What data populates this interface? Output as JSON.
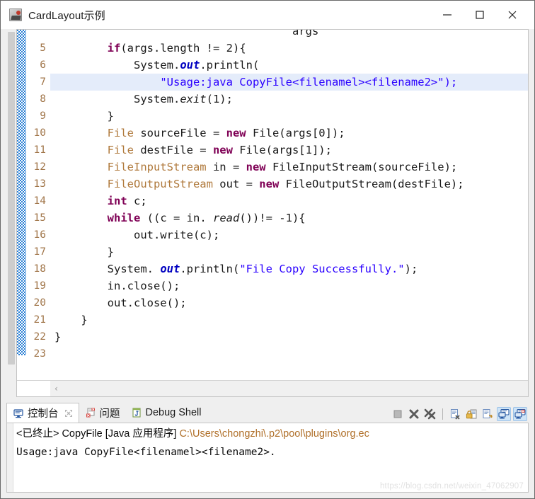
{
  "window": {
    "title": "CardLayout示例",
    "icon": "app-icon",
    "minimize_label": "—",
    "maximize_label": "□",
    "close_label": "✕"
  },
  "editor": {
    "first_visible_line": 5,
    "highlighted_line": 7,
    "line_numbers": [
      "5",
      "6",
      "7",
      "8",
      "9",
      "10",
      "11",
      "12",
      "13",
      "14",
      "15",
      "16",
      "17",
      "18",
      "19",
      "20",
      "21",
      "22",
      "23"
    ],
    "lines": [
      "        if(args.length != 2){",
      "            System.out.println(",
      "                \"Usage:java CopyFile<filenamel><filename2>\");",
      "            System.exit(1);",
      "        }",
      "        File sourceFile = new File(args[0]);",
      "        File destFile = new File(args[1]);",
      "        FileInputStream in = new FileInputStream(sourceFile);",
      "        FileOutputStream out = new FileOutputStream(destFile);",
      "        int c;",
      "        while ((c = in. read())!= -1){",
      "            out.write(c);",
      "        }",
      "        System. out.println(\"File Copy Successfully.\");",
      "        in.close();",
      "        out.close();",
      "    }",
      "}",
      ""
    ],
    "hscroll_left_arrow": "‹"
  },
  "console": {
    "tabs": [
      {
        "label": "控制台",
        "icon": "console-icon",
        "active": true,
        "pinned": true
      },
      {
        "label": "问题",
        "icon": "problems-icon",
        "active": false,
        "pinned": false
      },
      {
        "label": "Debug Shell",
        "icon": "debug-shell-icon",
        "active": false,
        "pinned": false
      }
    ],
    "toolbar": [
      {
        "name": "terminate-button",
        "icon": "stop-square-icon",
        "selected": false
      },
      {
        "name": "remove-launch-button",
        "icon": "x-bold-icon",
        "selected": false
      },
      {
        "name": "remove-all-terminated-button",
        "icon": "xx-bold-icon",
        "selected": false
      },
      {
        "name": "separator",
        "icon": "separator",
        "selected": false
      },
      {
        "name": "clear-console-button",
        "icon": "clear-page-icon",
        "selected": false
      },
      {
        "name": "scroll-lock-button",
        "icon": "lock-icon",
        "selected": false
      },
      {
        "name": "word-wrap-button",
        "icon": "wrap-icon",
        "selected": false
      },
      {
        "name": "display-selected-console-button",
        "icon": "display-console-icon",
        "selected": true
      },
      {
        "name": "open-console-button",
        "icon": "open-console-icon",
        "selected": true
      }
    ],
    "output": [
      {
        "prefix": "<已终止> CopyFile [Java 应用程序] ",
        "path": "C:\\Users\\chongzhi\\.p2\\pool\\plugins\\org.ec",
        "type": "meta"
      },
      {
        "text": "Usage:java CopyFile<filenamel><filename2>.",
        "type": "stdout"
      }
    ]
  },
  "watermark": "https://blog.csdn.net/weixin_47062907",
  "colors": {
    "keyword": "#7f0055",
    "string": "#2a00ff",
    "field": "#0000c0",
    "type": "#b07a3d",
    "line_number": "#a1764a",
    "highlight_row": "#e4ecfa",
    "change_bar": "#2a7fd4",
    "console_path": "#b0702a",
    "tab_active_bg": "#ffffff",
    "window_bg": "#efefef"
  }
}
